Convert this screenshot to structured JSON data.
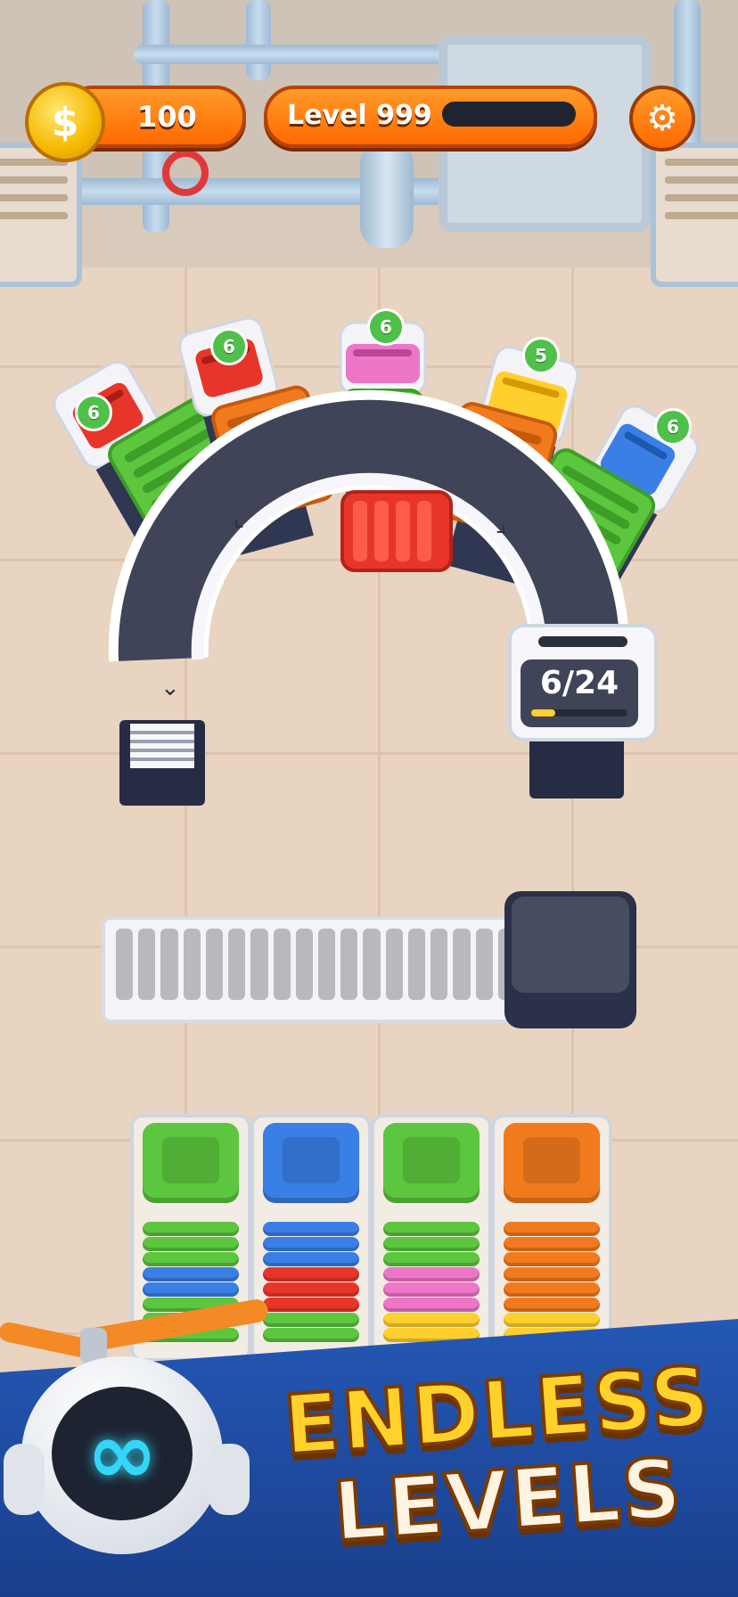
{
  "hud": {
    "coin_symbol": "$",
    "coins": "100",
    "level_label": "Level 999",
    "settings_icon": "gear-icon",
    "level_progress": 0.0
  },
  "counter": {
    "text": "6/24",
    "progress": 0.25
  },
  "bins": [
    {
      "color": "red",
      "count": "6"
    },
    {
      "color": "red",
      "count": "6"
    },
    {
      "color": "pink",
      "count": "6"
    },
    {
      "color": "yellow",
      "count": "5"
    },
    {
      "color": "blue",
      "count": "6"
    }
  ],
  "stacks": [
    {
      "top": "green",
      "layers": [
        "green",
        "green",
        "green",
        "blue",
        "blue",
        "green",
        "green",
        "green"
      ]
    },
    {
      "top": "blue",
      "layers": [
        "blue",
        "blue",
        "blue",
        "red",
        "red",
        "red",
        "green",
        "green"
      ]
    },
    {
      "top": "green",
      "layers": [
        "green",
        "green",
        "green",
        "pink",
        "pink",
        "pink",
        "yellow",
        "yellow"
      ]
    },
    {
      "top": "orange",
      "layers": [
        "orange",
        "orange",
        "orange",
        "orange",
        "orange",
        "orange",
        "yellow",
        "yellow"
      ]
    }
  ],
  "banner": {
    "line1": "ENDLESS",
    "line2": "LEVELS",
    "mascot_icon": "infinity-icon"
  },
  "colors": {
    "red": "#e8352a",
    "green": "#5cc63e",
    "orange": "#f27a1e",
    "pink": "#ee76c9",
    "yellow": "#ffcf2e",
    "blue": "#3a7fe6",
    "hud_orange": "#ff7a10",
    "banner_blue": "#2458b5"
  }
}
